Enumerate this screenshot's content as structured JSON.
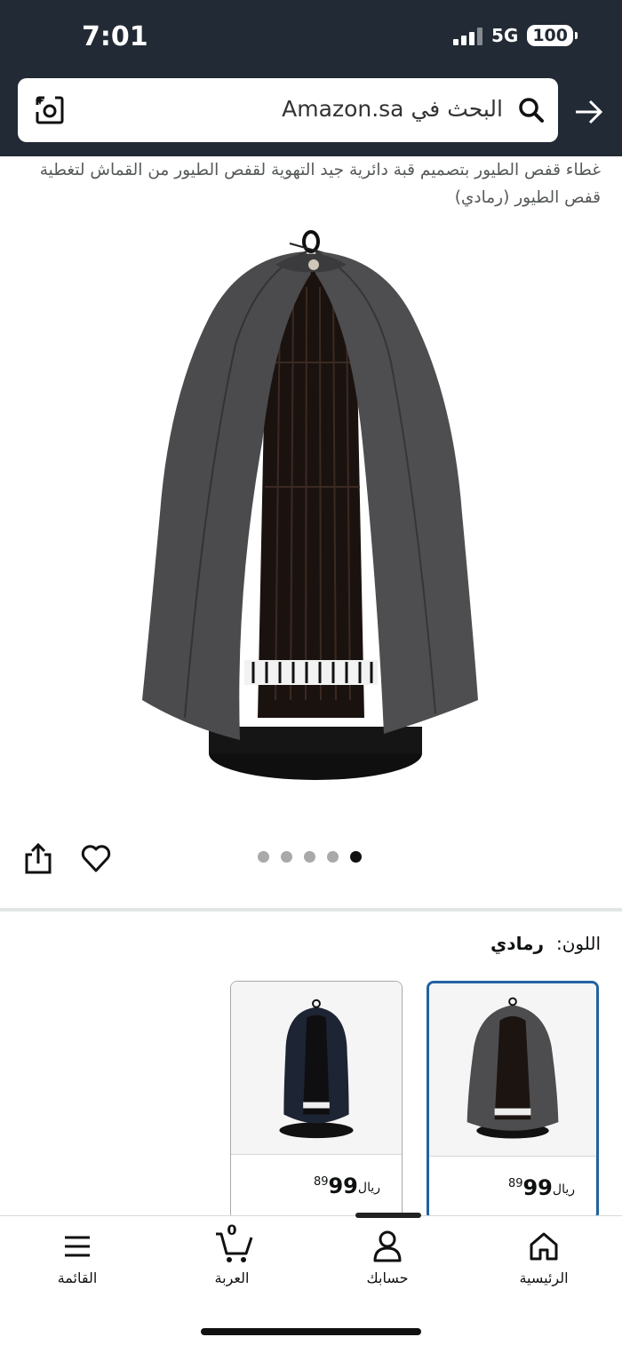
{
  "status_bar": {
    "time": "7:01",
    "network": "5G",
    "battery": "100"
  },
  "search": {
    "placeholder": "البحث في Amazon.sa"
  },
  "product": {
    "title": "غطاء قفص الطيور بتصميم قبة دائرية جيد التهوية لقفص الطيور من القماش لتغطية قفص الطيور (رمادي)",
    "image_count": 5,
    "active_image_index": 4
  },
  "variation": {
    "label": "اللون:",
    "value": "رمادي",
    "options": [
      {
        "name": "gray",
        "color": "#4a4a4c",
        "price_currency": "ريال",
        "price_main": "99",
        "price_fraction": "89",
        "selected": true
      },
      {
        "name": "navy",
        "color": "#1d2433",
        "price_currency": "ريال",
        "price_main": "99",
        "price_fraction": "89",
        "selected": false
      }
    ]
  },
  "bottom_nav": {
    "home": "الرئيسية",
    "account": "حسابك",
    "cart": "العربة",
    "cart_count": "0",
    "menu": "القائمة"
  },
  "colors": {
    "header_bg": "#222a35",
    "selected_border": "#2162a1"
  }
}
